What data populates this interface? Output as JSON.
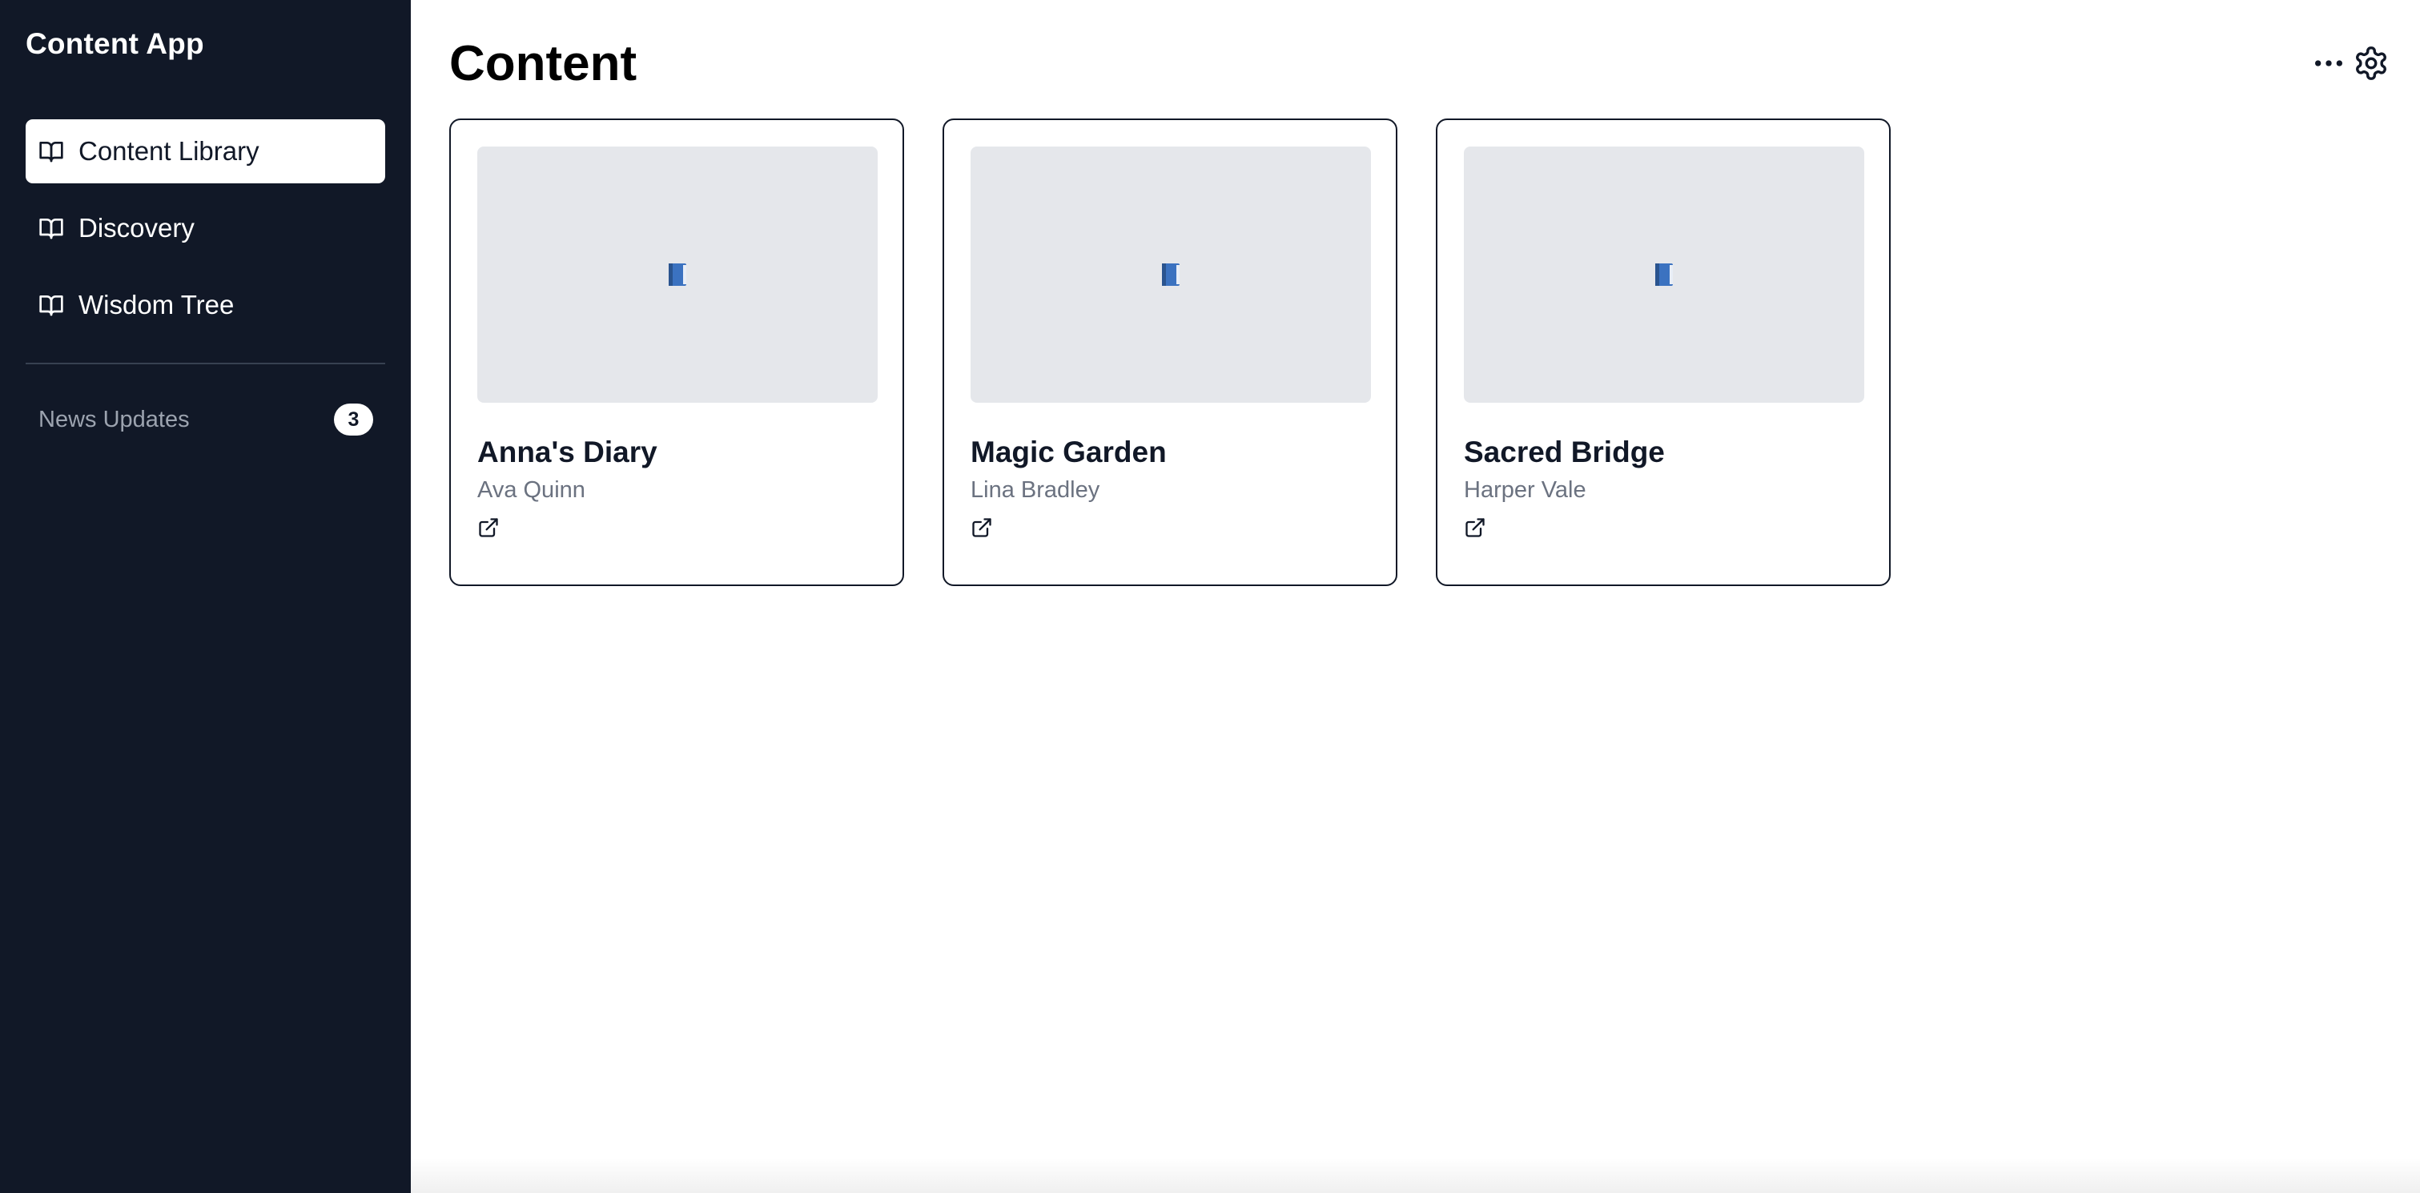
{
  "sidebar": {
    "app_title": "Content App",
    "nav_items": [
      {
        "label": "Content Library",
        "icon": "book-open-icon",
        "active": true
      },
      {
        "label": "Discovery",
        "icon": "book-open-icon",
        "active": false
      },
      {
        "label": "Wisdom Tree",
        "icon": "book-open-icon",
        "active": false
      }
    ],
    "news": {
      "label": "News Updates",
      "count": "3"
    }
  },
  "main": {
    "page_title": "Content",
    "actions": {
      "more_icon": "more-horizontal-icon",
      "settings_icon": "gear-icon"
    },
    "cards": [
      {
        "title": "Anna's Diary",
        "author": "Ava Quinn",
        "thumbnail_icon": "blue-book-icon",
        "link_icon": "external-link-icon"
      },
      {
        "title": "Magic Garden",
        "author": "Lina Bradley",
        "thumbnail_icon": "blue-book-icon",
        "link_icon": "external-link-icon"
      },
      {
        "title": "Sacred Bridge",
        "author": "Harper Vale",
        "thumbnail_icon": "blue-book-icon",
        "link_icon": "external-link-icon"
      }
    ]
  },
  "colors": {
    "sidebar_bg": "#111827",
    "thumbnail_bg": "#e5e7eb",
    "muted_text": "#6b7280",
    "book_blue": "#3b72c0"
  }
}
